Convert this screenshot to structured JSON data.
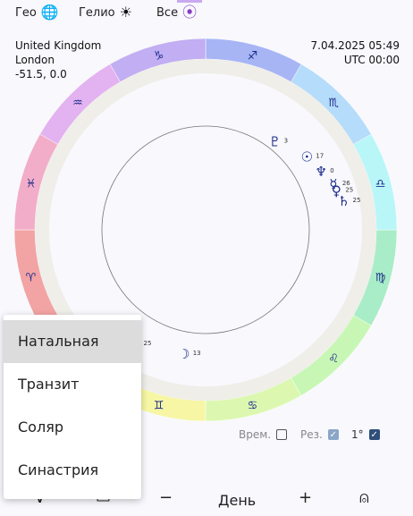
{
  "top_modes": [
    {
      "label": "Гео",
      "icon": "globe-icon",
      "glyph": "🌐"
    },
    {
      "label": "Гелио",
      "icon": "sun-icon",
      "glyph": "☀"
    },
    {
      "label": "Все",
      "icon": "target-icon",
      "glyph": "⦿"
    }
  ],
  "location": {
    "country": "United Kingdom",
    "city": "London",
    "coords": "-51.5, 0.0"
  },
  "datetime": {
    "date": "7.04.2025 05:49",
    "tz": "UTC 00:00"
  },
  "zodiac": [
    {
      "sign": "aries",
      "glyph": "♈",
      "color": "#f2a3a3"
    },
    {
      "sign": "taurus",
      "glyph": "♉",
      "color": "#f5b0b0"
    },
    {
      "sign": "gemini",
      "glyph": "♊",
      "color": "#f6f6a5"
    },
    {
      "sign": "cancer",
      "glyph": "♋",
      "color": "#dcf8b0"
    },
    {
      "sign": "leo",
      "glyph": "♌",
      "color": "#c8f7b5"
    },
    {
      "sign": "virgo",
      "glyph": "♍",
      "color": "#a8edc7"
    },
    {
      "sign": "libra",
      "glyph": "♎",
      "color": "#b9f6f8"
    },
    {
      "sign": "scorpio",
      "glyph": "♏",
      "color": "#b5dcfa"
    },
    {
      "sign": "sagittarius",
      "glyph": "♐",
      "color": "#a7b5f5"
    },
    {
      "sign": "capricorn",
      "glyph": "♑",
      "color": "#c2aef2"
    },
    {
      "sign": "aquarius",
      "glyph": "♒",
      "color": "#e3b2f0"
    },
    {
      "sign": "pisces",
      "glyph": "♓",
      "color": "#f2adc8"
    }
  ],
  "planets": [
    {
      "name": "pluto",
      "glyph": "♇",
      "degree": "3",
      "color": "#1a2b8a"
    },
    {
      "name": "saturn",
      "glyph": "♄",
      "degree": "25",
      "color": "#1a2b8a"
    },
    {
      "name": "venus",
      "glyph": "♀",
      "degree": "25",
      "color": "#1a2b8a"
    },
    {
      "name": "mercury",
      "glyph": "☿",
      "degree": "26",
      "color": "#1a2b8a"
    },
    {
      "name": "neptune",
      "glyph": "♆",
      "degree": "0",
      "color": "#1a2b8a"
    },
    {
      "name": "sun",
      "glyph": "☉",
      "degree": "17",
      "color": "#1a2b8a"
    },
    {
      "name": "moon",
      "glyph": "☽",
      "degree": "13",
      "color": "#1a2b8a"
    },
    {
      "name": "mars",
      "glyph": "♂",
      "degree": "25",
      "color": "#1a2b8a"
    },
    {
      "name": "jupiter",
      "glyph": "♃",
      "degree": "16",
      "color": "#1a2b8a"
    }
  ],
  "controls": {
    "time_label": "Врем.",
    "res_label": "Рез.",
    "one_degree_label": "1°"
  },
  "bottom": {
    "period_label": "День",
    "minus": "−",
    "plus": "+"
  },
  "menu": {
    "items": [
      "Натальная",
      "Транзит",
      "Соляр",
      "Синастрия"
    ],
    "selected_index": 0
  }
}
